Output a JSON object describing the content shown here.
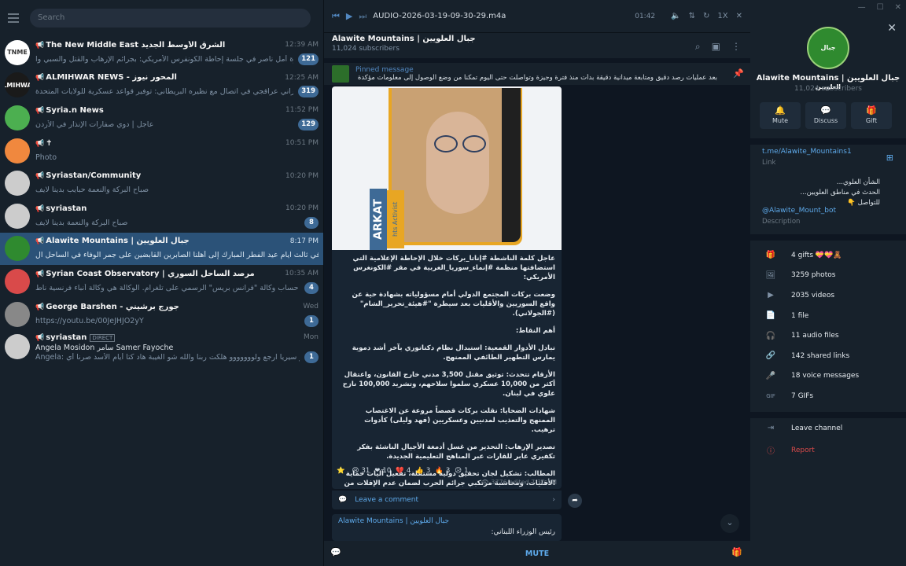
{
  "sidebar": {
    "search_placeholder": "Search",
    "chats": [
      {
        "title": "The New Middle East الشرق الأوسط الجديد",
        "time": "12:39 AM",
        "preview": "مشاركة الدكتورة أمل ناصر في جلسة إحاطة الكونفرس الأمريكي: بجرائم الإرهاب والقتل والسبي وا...",
        "badge": "121",
        "avatar_color": "#ffffff",
        "avatar_text": "TNME"
      },
      {
        "title": "ALMIHWAR NEWS - المحور نيوز",
        "time": "12:25 AM",
        "preview": "وزير الخارجية الإيراني عراقجي في اتصال مع نظيره البريطاني: توفير قواعد عسكرية للولايات المتحدة ...",
        "badge": "319",
        "avatar_color": "#1a1a1a",
        "avatar_text": "ALMIHWAR"
      },
      {
        "title": "Syria.n News",
        "time": "11:52 PM",
        "preview": "عاجل | دوي صفارات الإنذار في الأردن",
        "badge": "129",
        "avatar_color": "#4caf50",
        "avatar_text": ""
      },
      {
        "title": "✝",
        "time": "10:51 PM",
        "preview": "Photo",
        "badge": "",
        "avatar_color": "#f0883e",
        "avatar_text": ""
      },
      {
        "title": "Syriastan/Community",
        "time": "10:20 PM",
        "preview": "صباح البركة والنعمة حبايب بدينا لايف",
        "badge": "",
        "avatar_color": "#cccccc",
        "avatar_text": ""
      },
      {
        "title": "syriastan",
        "time": "10:20 PM",
        "preview": "صباح البركة والنعمة بدينا لايف",
        "badge": "8",
        "avatar_color": "#cccccc",
        "avatar_text": ""
      },
      {
        "title": "Alawite Mountains | جبال العلويين",
        "time": "8:17 PM",
        "preview": "في ثالث ايام عيد الفطر المبارك إلى أهلنا الصابرين القابضين على جمر الوفاء في الساحل ال...",
        "badge": "",
        "avatar_color": "#2f8a2f",
        "avatar_text": ""
      },
      {
        "title": "Syrian Coast Observatory | مرصد الساحل السوري",
        "time": "10:35 AM",
        "preview": "تدعوكم للانضمام إلى حساب وكالة \"فرانس بريس\" الرسمي على تلغرام. الوكالة هي وكالة أنباء فرنسية ناط...",
        "badge": "4",
        "avatar_color": "#d94a4a",
        "avatar_text": ""
      },
      {
        "title": "George Barshen - جورج برشيني",
        "time": "Wed",
        "preview": "https://youtu.be/00JeJHJO2yY",
        "badge": "1",
        "avatar_color": "#888888",
        "avatar_text": ""
      },
      {
        "title": "syriastan",
        "time": "Mon",
        "preview": "Angela: اشتقنا لك كتير سيريا ارجع ولووووووو هلكت ربنا والله شو الغيبة هاد كتا أيام الأسد صرنا أي...",
        "badge": "1",
        "avatar_color": "#cccccc",
        "avatar_text": "",
        "direct": "DIRECT",
        "members": "Angela  Mosidon  سامر Samer  Fayoche"
      }
    ]
  },
  "player": {
    "title": "AUDIO-2026-03-19-09-30-29.m4a",
    "time": "01:42",
    "speed": "1X"
  },
  "channel": {
    "title": "Alawite Mountains | جبال العلويين",
    "subscribers": "11,024 subscribers",
    "pinned_label": "Pinned message",
    "pinned_text": "بعد عمليات رصد دقيق ومتابعة ميدانية دقيقة بدأت منذ فترة وجيزة وتواصلت حتى اليوم تمكنا من وضع الوصول إلى معلومات مؤكدة ..."
  },
  "post": {
    "media_tag1": "ARKAT",
    "media_tag2": "hts Activist",
    "paragraphs": [
      "عاجل كلمة الناشطة #إناتا_بركات خلال الإحاطة الإعلامية التي استضافتها منظمة #إنماء_سوريا_الغربية في مقر #الكونغرس الأمريكي:",
      "وضعت بركات المجتمع الدولي أمام مسؤولياته بشهادة حية عن واقع السوريين والأقليات بعد سيطرة \"#هيئة_تحرير_الشام\" (#الجولاني).",
      "أهم النقاط:",
      "تبادل الأدوار القمعية: استبدال نظام دكتاتوري بآخر أشد دموية يمارس التطهير الطائفي الممنهج.",
      "الأرقام تتحدث: توثيق مقتل 3,500 مدني خارج القانون، واعتقال أكثر من 10,000 عسكري سلموا سلاحهم، وتشريد 100,000 نازح علوي في لبنان.",
      "شهادات الضحايا: نقلت بركات قصصاً مروعة عن الاغتصاب الممنهج والتعذيب لمدنيين وعسكريين (فهد وليلى) كأدوات ترهيب.",
      "تصدير الإرهاب: التحذير من غسل أدمغة الأجيال الناشئة بفكر تكفيري عابر للقارات عبر المناهج التعليمية الجديدة.",
      "المطالب: تشكيل لجان تحقيق دولية مستقلة، تفعيل آليات حماية الأقليات، ومحاسبة مرتكبي جرائم الحرب لضمان عدم الإفلات من العقاب وفق القانون الدولي."
    ],
    "reactions": [
      {
        "emoji": "⭐",
        "count": ""
      },
      {
        "emoji": "😢",
        "count": "31"
      },
      {
        "emoji": "❤",
        "count": "10"
      },
      {
        "emoji": "💔",
        "count": "4"
      },
      {
        "emoji": "👍",
        "count": "3"
      },
      {
        "emoji": "🔥",
        "count": "3"
      },
      {
        "emoji": "😥",
        "count": "1"
      }
    ],
    "views": "3776",
    "edited": "edited 7:30 AM",
    "comment_label": "Leave a comment"
  },
  "post2": {
    "title": "Alawite Mountains | جبال العلويين",
    "text": "رئيس الوزراء اللبناني:"
  },
  "bottom": {
    "mute_label": "MUTE"
  },
  "right_panel": {
    "name": "Alawite Mountains | جبال العلويين",
    "subscribers": "11,024 subscribers",
    "avatar_text": "جبال العلويين",
    "actions": [
      {
        "icon": "bell-icon",
        "label": "Mute"
      },
      {
        "icon": "discuss-icon",
        "label": "Discuss"
      },
      {
        "icon": "gift-icon",
        "label": "Gift"
      }
    ],
    "link": "t.me/Alawite_Mountains1",
    "link_label": "Link",
    "description": "الشأن العلوي...\nالحدث في مناطق العلويين...\nللتواصل 👇",
    "bot": "@Alawite_Mount_bot",
    "description_label": "Description",
    "stats": [
      {
        "icon": "gift-icon",
        "label": "4 gifts 💝💝🧸"
      },
      {
        "icon": "photo-icon",
        "label": "3259 photos"
      },
      {
        "icon": "video-icon",
        "label": "2035 videos"
      },
      {
        "icon": "file-icon",
        "label": "1 file"
      },
      {
        "icon": "audio-icon",
        "label": "11 audio files"
      },
      {
        "icon": "link-icon",
        "label": "142 shared links"
      },
      {
        "icon": "mic-icon",
        "label": "18 voice messages"
      },
      {
        "icon": "gif-icon",
        "label": "7 GIFs"
      }
    ],
    "leave_label": "Leave channel",
    "report_label": "Report"
  }
}
